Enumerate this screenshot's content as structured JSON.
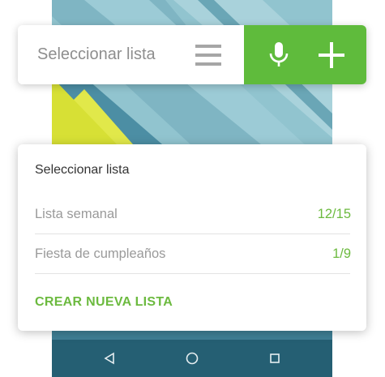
{
  "search": {
    "placeholder": "Seleccionar lista",
    "menu_icon": "menu-icon",
    "mic_icon": "microphone-icon",
    "add_icon": "plus-icon"
  },
  "dropdown": {
    "title": "Seleccionar lista",
    "lists": [
      {
        "name": "Lista semanal",
        "count": "12/15"
      },
      {
        "name": "Fiesta de cumpleaños",
        "count": "1/9"
      }
    ],
    "create_label": "CREAR NUEVA LISTA"
  },
  "navbar": {
    "icons": [
      "back-icon",
      "home-icon",
      "recents-icon"
    ]
  },
  "colors": {
    "accent_green": "#5fbb3c",
    "count_green": "#6cba3f",
    "navbar": "#255f73"
  }
}
